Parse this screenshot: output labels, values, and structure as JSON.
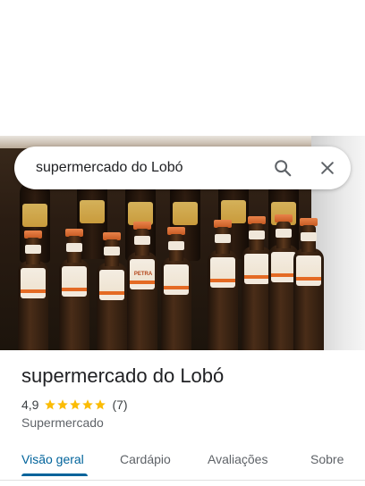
{
  "search": {
    "query": "supermercado do Lobó"
  },
  "place": {
    "name": "supermercado do Lobó",
    "rating": "4,9",
    "stars": 5,
    "review_count": "(7)",
    "category": "Supermercado"
  },
  "tabs": [
    {
      "label": "Visão geral",
      "active": true
    },
    {
      "label": "Cardápio",
      "active": false
    },
    {
      "label": "Avaliações",
      "active": false
    },
    {
      "label": "Sobre",
      "active": false
    }
  ],
  "colors": {
    "accent": "#00639b",
    "star": "#fbbc04",
    "text_primary": "#202124",
    "text_secondary": "#5f6368"
  },
  "icons": {
    "search": "search-icon",
    "close": "close-icon",
    "star": "star-icon"
  },
  "photo": {
    "label_text": "PETRA"
  }
}
